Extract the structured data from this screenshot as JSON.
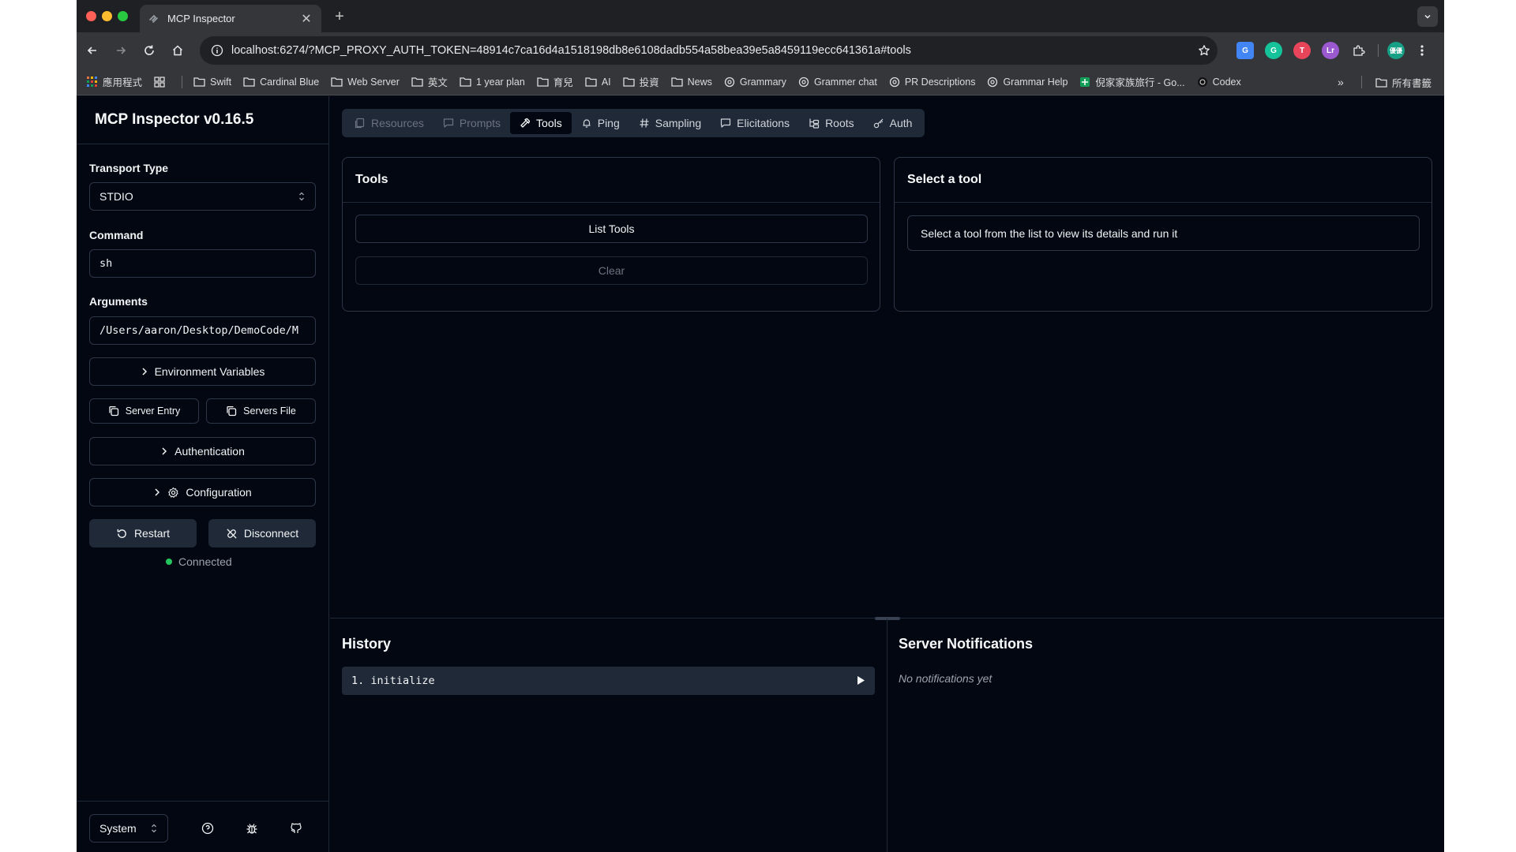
{
  "browser": {
    "tab_title": "MCP Inspector",
    "url": "localhost:6274/?MCP_PROXY_AUTH_TOKEN=48914c7ca16d4a1518198db8e6108dadb554a58bea39e5a8459119ecc641361a#tools",
    "profile_badge": "優優",
    "bookmarks": [
      "應用程式",
      "Swift",
      "Cardinal Blue",
      "Web Server",
      "英文",
      "1 year plan",
      "育兒",
      "AI",
      "投資",
      "News",
      "Grammary",
      "Grammer chat",
      "PR Descriptions",
      "Grammar Help",
      "倪家家族旅行 - Go...",
      "Codex"
    ],
    "all_bookmarks": "所有書籤",
    "more": "»"
  },
  "sidebar": {
    "title": "MCP Inspector v0.16.5",
    "transport_label": "Transport Type",
    "transport_value": "STDIO",
    "command_label": "Command",
    "command_value": "sh",
    "arguments_label": "Arguments",
    "arguments_value": "/Users/aaron/Desktop/DemoCode/M",
    "env_vars": "Environment Variables",
    "server_entry": "Server Entry",
    "servers_file": "Servers File",
    "authentication": "Authentication",
    "configuration": "Configuration",
    "restart": "Restart",
    "disconnect": "Disconnect",
    "status": "Connected",
    "theme": "System"
  },
  "tabs": {
    "resources": "Resources",
    "prompts": "Prompts",
    "tools": "Tools",
    "ping": "Ping",
    "sampling": "Sampling",
    "elicitations": "Elicitations",
    "roots": "Roots",
    "auth": "Auth"
  },
  "tools_panel": {
    "title": "Tools",
    "list_tools": "List Tools",
    "clear": "Clear"
  },
  "detail_panel": {
    "title": "Select a tool",
    "hint": "Select a tool from the list to view its details and run it"
  },
  "history": {
    "title": "History",
    "items": [
      "1. initialize"
    ]
  },
  "notifications": {
    "title": "Server Notifications",
    "empty": "No notifications yet"
  },
  "colors": {
    "background": "#030712",
    "border": "#2d3748",
    "connected": "#22c55e"
  }
}
